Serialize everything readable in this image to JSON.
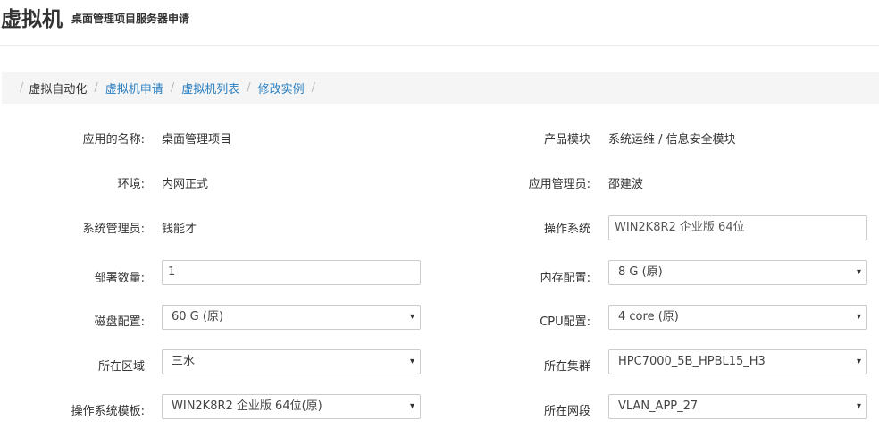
{
  "header": {
    "title": "虚拟机",
    "subtitle": "桌面管理项目服务器申请"
  },
  "breadcrumb": [
    {
      "label": "虚拟自动化",
      "link": false
    },
    {
      "label": "虚拟机申请",
      "link": true
    },
    {
      "label": "虚拟机列表",
      "link": true
    },
    {
      "label": "修改实例",
      "link": true
    }
  ],
  "breadcrumb_sep": "/",
  "form": {
    "app_name": {
      "label": "应用的名称:",
      "value": "桌面管理项目"
    },
    "product_module": {
      "label": "产品模块",
      "value": "系统运维 / 信息安全模块"
    },
    "environment": {
      "label": "环境:",
      "value": "内网正式"
    },
    "app_admin": {
      "label": "应用管理员:",
      "value": "邵建波"
    },
    "sys_admin": {
      "label": "系统管理员:",
      "value": "钱能才"
    },
    "os": {
      "label": "操作系统",
      "value": "WIN2K8R2 企业版 64位"
    },
    "deploy_count": {
      "label": "部署数量:",
      "value": "1"
    },
    "memory": {
      "label": "内存配置:",
      "value": "8 G (原)"
    },
    "disk": {
      "label": "磁盘配置:",
      "value": "60 G (原)"
    },
    "cpu": {
      "label": "CPU配置:",
      "value": "4 core (原)"
    },
    "zone": {
      "label": "所在区域",
      "value": "三水"
    },
    "cluster": {
      "label": "所在集群",
      "value": "HPC7000_5B_HPBL15_H3"
    },
    "os_template": {
      "label": "操作系统模板:",
      "value": "WIN2K8R2 企业版 64位(原)"
    },
    "network": {
      "label": "所在网段",
      "value": "VLAN_APP_27"
    }
  },
  "caret_icon": "▾"
}
